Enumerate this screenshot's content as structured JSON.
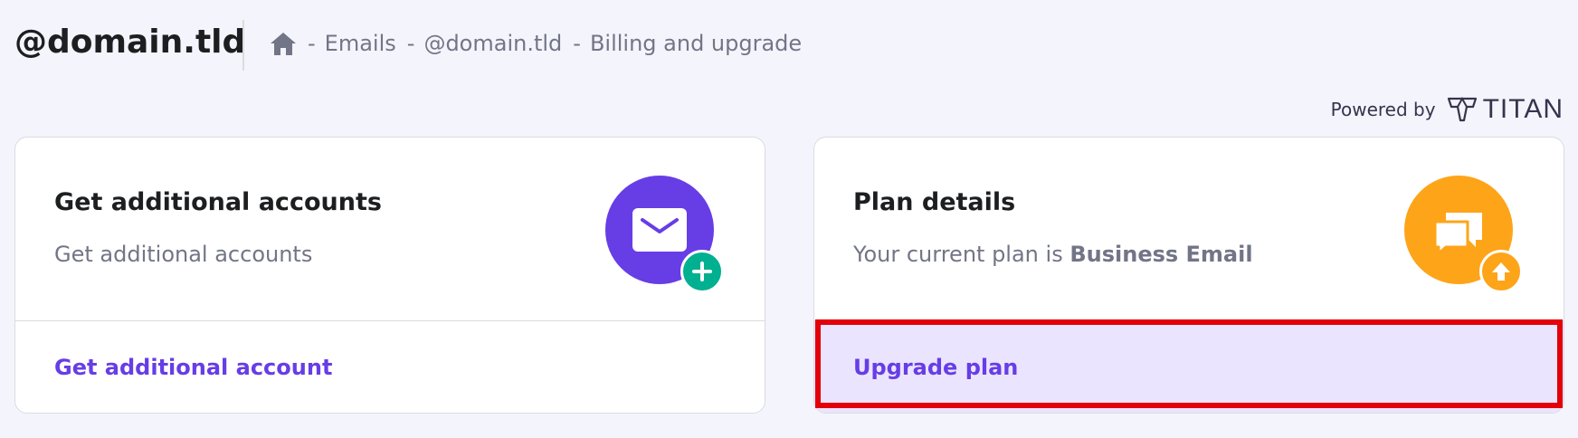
{
  "header": {
    "title": "@domain.tld",
    "breadcrumb": {
      "separator": "-",
      "items": [
        "Emails",
        "@domain.tld",
        "Billing and upgrade"
      ]
    }
  },
  "powered_by": {
    "label": "Powered by",
    "brand": "TITAN"
  },
  "cards": {
    "accounts": {
      "title": "Get additional accounts",
      "description": "Get additional accounts",
      "action_label": "Get additional account",
      "icon": "mail-icon",
      "badge_icon": "plus-icon",
      "icon_color": "#673de6",
      "badge_color": "#00b090"
    },
    "plan": {
      "title": "Plan details",
      "description_prefix": "Your current plan is",
      "plan_name": "Business Email",
      "action_label": "Upgrade plan",
      "icon": "chat-icon",
      "badge_icon": "upgrade-arrow-icon",
      "icon_color": "#fea419",
      "badge_color": "#fea419"
    }
  },
  "colors": {
    "background": "#f4f4fc",
    "accent": "#673de6",
    "highlight": "#e3000b"
  }
}
